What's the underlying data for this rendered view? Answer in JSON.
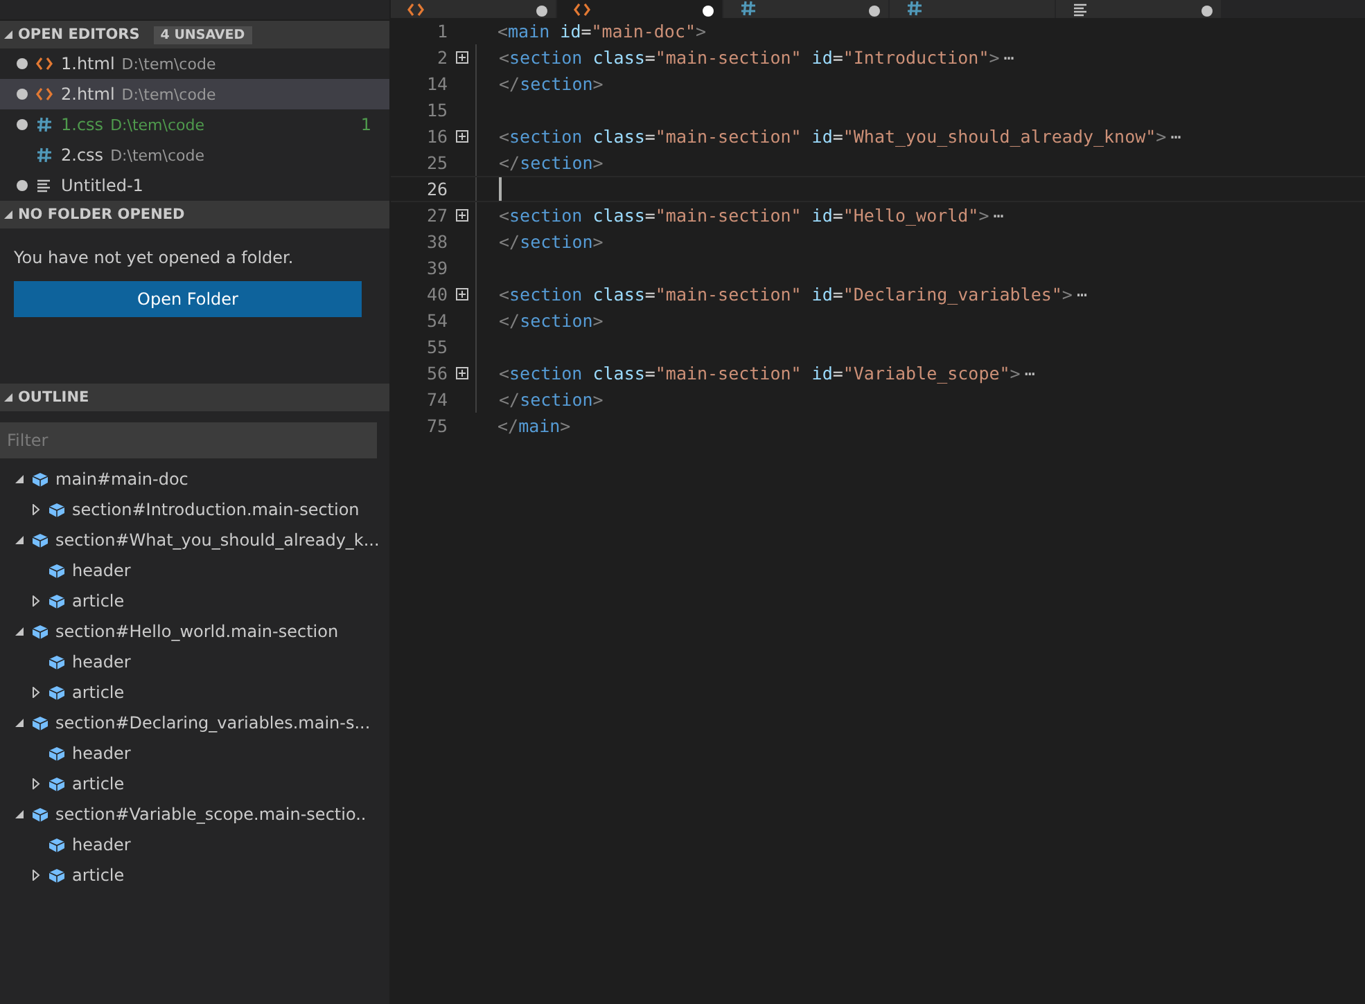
{
  "editor_tabs": [
    {
      "kind": "html",
      "selected": false,
      "dirty": true
    },
    {
      "kind": "html",
      "selected": true,
      "dirty": true
    },
    {
      "kind": "css",
      "selected": false,
      "dirty": true
    },
    {
      "kind": "css",
      "selected": false,
      "dirty": false
    },
    {
      "kind": "text",
      "selected": false,
      "dirty": true
    }
  ],
  "open_editors": {
    "title": "OPEN EDITORS",
    "badge": "4 UNSAVED",
    "items": [
      {
        "name": "1.html",
        "path": "D:\\tem\\code",
        "kind": "html",
        "dirty": true,
        "selected": false,
        "modified": false
      },
      {
        "name": "2.html",
        "path": "D:\\tem\\code",
        "kind": "html",
        "dirty": true,
        "selected": true,
        "modified": false
      },
      {
        "name": "1.css",
        "path": "D:\\tem\\code",
        "kind": "css",
        "dirty": true,
        "selected": false,
        "modified": true,
        "count": "1"
      },
      {
        "name": "2.css",
        "path": "D:\\tem\\code",
        "kind": "css",
        "dirty": false,
        "selected": false,
        "modified": false
      },
      {
        "name": "Untitled-1",
        "kind": "text",
        "dirty": true,
        "selected": false,
        "modified": false
      }
    ]
  },
  "no_folder": {
    "title": "NO FOLDER OPENED",
    "message": "You have not yet opened a folder.",
    "button": "Open Folder"
  },
  "outline": {
    "title": "OUTLINE",
    "filter_placeholder": "Filter",
    "items": [
      {
        "label": "main#main-doc",
        "expanded": true,
        "children": [
          {
            "label": "section#Introduction.main-section",
            "expanded": false
          }
        ]
      },
      {
        "label": "section#What_you_should_already_k...",
        "expanded": true,
        "children": [
          {
            "label": "header"
          },
          {
            "label": "article",
            "expanded": false
          }
        ]
      },
      {
        "label": "section#Hello_world.main-section",
        "expanded": true,
        "children": [
          {
            "label": "header"
          },
          {
            "label": "article",
            "expanded": false
          }
        ]
      },
      {
        "label": "section#Declaring_variables.main-s...",
        "expanded": true,
        "children": [
          {
            "label": "header"
          },
          {
            "label": "article",
            "expanded": false
          }
        ]
      },
      {
        "label": "section#Variable_scope.main-sectio..",
        "expanded": true,
        "children": [
          {
            "label": "header"
          },
          {
            "label": "article",
            "expanded": false
          }
        ]
      }
    ]
  },
  "code": {
    "lines": [
      {
        "number": "1",
        "indent": false,
        "folded": false,
        "current": false,
        "tokens": [
          {
            "kind": "punct",
            "text": "<"
          },
          {
            "kind": "tag",
            "text": "main"
          },
          {
            "kind": "attr",
            "text": " id"
          },
          {
            "kind": "plain",
            "text": "="
          },
          {
            "kind": "string",
            "text": "\"main-doc\""
          },
          {
            "kind": "punct",
            "text": ">"
          }
        ]
      },
      {
        "number": "2",
        "indent": true,
        "folded": true,
        "current": false,
        "ellipsis": "⋯",
        "tokens": [
          {
            "kind": "punct",
            "text": "<"
          },
          {
            "kind": "tag",
            "text": "section"
          },
          {
            "kind": "attr",
            "text": " class"
          },
          {
            "kind": "plain",
            "text": "="
          },
          {
            "kind": "string",
            "text": "\"main-section\""
          },
          {
            "kind": "attr",
            "text": " id"
          },
          {
            "kind": "plain",
            "text": "="
          },
          {
            "kind": "string",
            "text": "\"Introduction\""
          },
          {
            "kind": "punct",
            "text": ">"
          }
        ]
      },
      {
        "number": "14",
        "indent": true,
        "folded": false,
        "current": false,
        "tokens": [
          {
            "kind": "punct",
            "text": "</"
          },
          {
            "kind": "tag",
            "text": "section"
          },
          {
            "kind": "punct",
            "text": ">"
          }
        ]
      },
      {
        "number": "15",
        "indent": true,
        "folded": false,
        "current": false
      },
      {
        "number": "16",
        "indent": true,
        "folded": true,
        "current": false,
        "ellipsis": "⋯",
        "tokens": [
          {
            "kind": "punct",
            "text": "<"
          },
          {
            "kind": "tag",
            "text": "section"
          },
          {
            "kind": "attr",
            "text": " class"
          },
          {
            "kind": "plain",
            "text": "="
          },
          {
            "kind": "string",
            "text": "\"main-section\""
          },
          {
            "kind": "attr",
            "text": " id"
          },
          {
            "kind": "plain",
            "text": "="
          },
          {
            "kind": "string",
            "text": "\"What_you_should_already_know\""
          },
          {
            "kind": "punct",
            "text": ">"
          }
        ]
      },
      {
        "number": "25",
        "indent": true,
        "folded": false,
        "current": false,
        "tokens": [
          {
            "kind": "punct",
            "text": "</"
          },
          {
            "kind": "tag",
            "text": "section"
          },
          {
            "kind": "punct",
            "text": ">"
          }
        ]
      },
      {
        "number": "26",
        "indent": true,
        "folded": false,
        "current": true
      },
      {
        "number": "27",
        "indent": true,
        "folded": true,
        "current": false,
        "ellipsis": "⋯",
        "tokens": [
          {
            "kind": "punct",
            "text": "<"
          },
          {
            "kind": "tag",
            "text": "section"
          },
          {
            "kind": "attr",
            "text": " class"
          },
          {
            "kind": "plain",
            "text": "="
          },
          {
            "kind": "string",
            "text": "\"main-section\""
          },
          {
            "kind": "attr",
            "text": " id"
          },
          {
            "kind": "plain",
            "text": "="
          },
          {
            "kind": "string",
            "text": "\"Hello_world\""
          },
          {
            "kind": "punct",
            "text": ">"
          }
        ]
      },
      {
        "number": "38",
        "indent": true,
        "folded": false,
        "current": false,
        "tokens": [
          {
            "kind": "punct",
            "text": "</"
          },
          {
            "kind": "tag",
            "text": "section"
          },
          {
            "kind": "punct",
            "text": ">"
          }
        ]
      },
      {
        "number": "39",
        "indent": true,
        "folded": false,
        "current": false
      },
      {
        "number": "40",
        "indent": true,
        "folded": true,
        "current": false,
        "ellipsis": "⋯",
        "tokens": [
          {
            "kind": "punct",
            "text": "<"
          },
          {
            "kind": "tag",
            "text": "section"
          },
          {
            "kind": "attr",
            "text": " class"
          },
          {
            "kind": "plain",
            "text": "="
          },
          {
            "kind": "string",
            "text": "\"main-section\""
          },
          {
            "kind": "attr",
            "text": " id"
          },
          {
            "kind": "plain",
            "text": "="
          },
          {
            "kind": "string",
            "text": "\"Declaring_variables\""
          },
          {
            "kind": "punct",
            "text": ">"
          }
        ]
      },
      {
        "number": "54",
        "indent": true,
        "folded": false,
        "current": false,
        "tokens": [
          {
            "kind": "punct",
            "text": "</"
          },
          {
            "kind": "tag",
            "text": "section"
          },
          {
            "kind": "punct",
            "text": ">"
          }
        ]
      },
      {
        "number": "55",
        "indent": true,
        "folded": false,
        "current": false
      },
      {
        "number": "56",
        "indent": true,
        "folded": true,
        "current": false,
        "ellipsis": "⋯",
        "tokens": [
          {
            "kind": "punct",
            "text": "<"
          },
          {
            "kind": "tag",
            "text": "section"
          },
          {
            "kind": "attr",
            "text": " class"
          },
          {
            "kind": "plain",
            "text": "="
          },
          {
            "kind": "string",
            "text": "\"main-section\""
          },
          {
            "kind": "attr",
            "text": " id"
          },
          {
            "kind": "plain",
            "text": "="
          },
          {
            "kind": "string",
            "text": "\"Variable_scope\""
          },
          {
            "kind": "punct",
            "text": ">"
          }
        ]
      },
      {
        "number": "74",
        "indent": true,
        "folded": false,
        "current": false,
        "tokens": [
          {
            "kind": "punct",
            "text": "</"
          },
          {
            "kind": "tag",
            "text": "section"
          },
          {
            "kind": "punct",
            "text": ">"
          }
        ]
      },
      {
        "number": "75",
        "indent": false,
        "folded": false,
        "current": false,
        "tokens": [
          {
            "kind": "punct",
            "text": "</"
          },
          {
            "kind": "tag",
            "text": "main"
          },
          {
            "kind": "punct",
            "text": ">"
          }
        ]
      }
    ]
  }
}
